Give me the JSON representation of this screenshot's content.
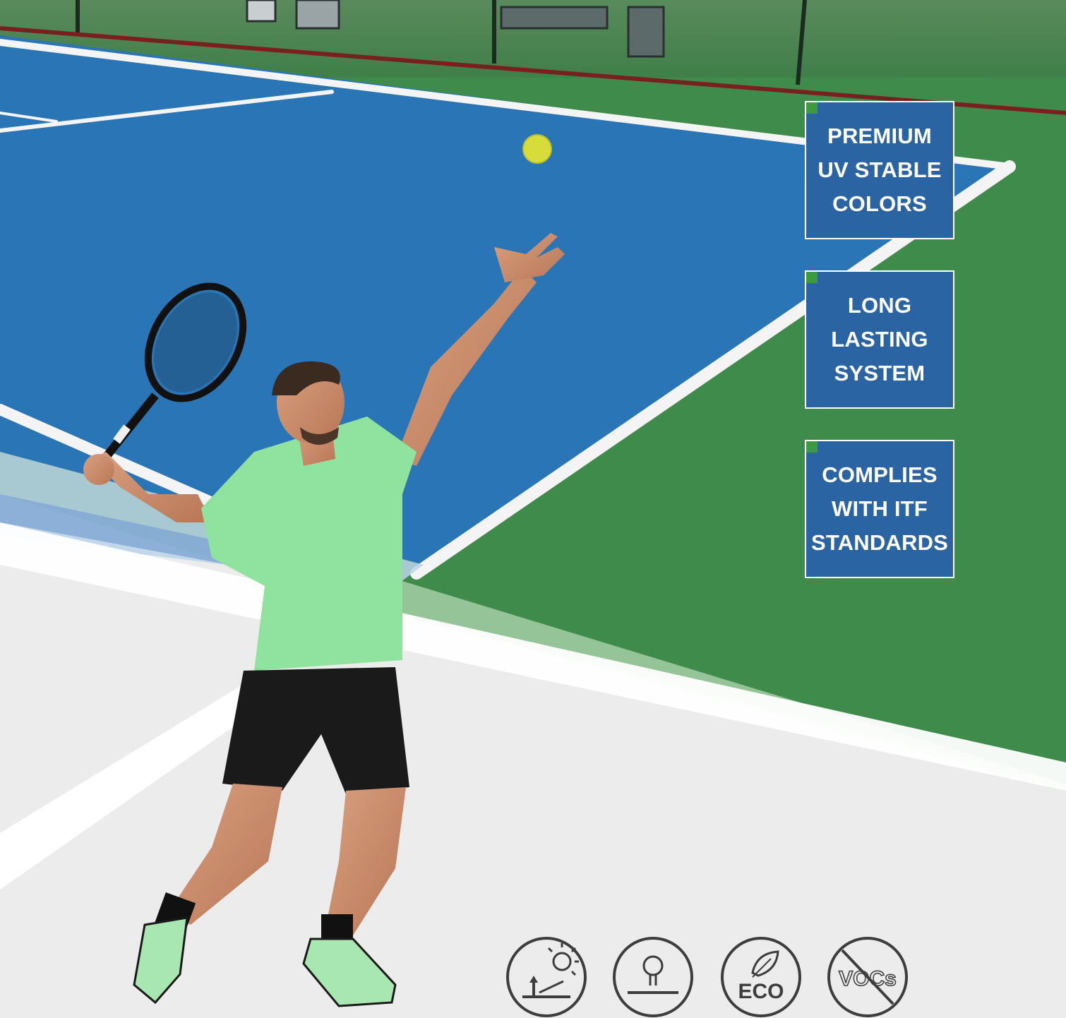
{
  "features": [
    {
      "label": "PREMIUM\nUV STABLE\nCOLORS"
    },
    {
      "label": "LONG\nLASTING\nSYSTEM"
    },
    {
      "label": "COMPLIES\nWITH ITF\nSTANDARDS"
    }
  ],
  "badges": [
    {
      "icon": "uv-resistance-icon"
    },
    {
      "icon": "surface-light-icon"
    },
    {
      "icon": "eco-leaf-icon",
      "text": "ECO"
    },
    {
      "icon": "no-vocs-icon",
      "text": "VOCs"
    }
  ],
  "colors": {
    "court_blue": "#2b74b4",
    "court_green": "#3d8a48",
    "shirt_green": "#8fe39f",
    "box_blue": "#2b64a3",
    "accent_green": "#3c9b41"
  }
}
